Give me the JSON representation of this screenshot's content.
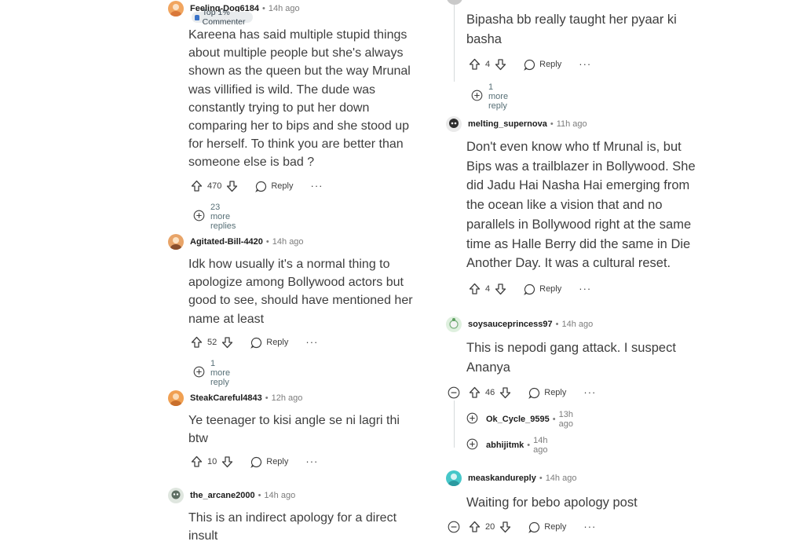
{
  "left": {
    "comments": [
      {
        "username": "Feeling-Dog6184",
        "time": "14h ago",
        "flair": "Top 1% Commenter",
        "body": "Kareena has said multiple stupid things about multiple people but she's always shown as the queen but the way Mrunal was villified is wild. The dude was constantly trying to put her down comparing her to bips and she stood up for herself. To think you are better than someone else is bad ?",
        "votes": "470",
        "reply_label": "Reply",
        "more_label": "···",
        "more_replies": "23 more replies",
        "avatar_color": "#f1a55f"
      },
      {
        "username": "Agitated-Bill-4420",
        "time": "14h ago",
        "body": "Idk how usually it's a normal thing to apologize among Bollywood actors but good to see, should have mentioned her name at least",
        "votes": "52",
        "reply_label": "Reply",
        "more_label": "···",
        "more_replies": "1 more reply",
        "avatar_color": "#e8a468"
      },
      {
        "username": "SteakCareful4843",
        "time": "12h ago",
        "body": "Ye teenager to kisi angle se ni lagri thi btw",
        "votes": "10",
        "reply_label": "Reply",
        "more_label": "···",
        "avatar_color": "#f0a052"
      },
      {
        "username": "the_arcane2000",
        "time": "14h ago",
        "body": "This is an indirect apology for a direct insult",
        "avatar_color": "#5d6e62"
      }
    ]
  },
  "right": {
    "comments": [
      {
        "id": "bipasha",
        "body": "Bipasha bb really taught her pyaar ki basha",
        "votes": "4",
        "reply_label": "Reply",
        "more_label": "···",
        "more_replies": "1 more reply"
      },
      {
        "username": "melting_supernova",
        "time": "11h ago",
        "body": "Don't even know who tf Mrunal is, but Bips was a trailblazer in Bollywood. She did Jadu Hai Nasha Hai emerging from the ocean like a vision that and no parallels in Bollywood right at the same time as Halle Berry did the same in Die Another Day. It was a cultural reset.",
        "votes": "4",
        "reply_label": "Reply",
        "more_label": "···",
        "avatar_color": "#3a3a3a"
      },
      {
        "username": "soysauceprincess97",
        "time": "14h ago",
        "body": "This is nepodi gang attack. I suspect Ananya",
        "votes": "46",
        "reply_label": "Reply",
        "more_label": "···",
        "avatar_color": "#cfe3d0",
        "sub_replies": [
          {
            "username": "Ok_Cycle_9595",
            "time": "13h ago"
          },
          {
            "username": "abhijitmk",
            "time": "14h ago"
          }
        ]
      },
      {
        "username": "measkandureply",
        "time": "14h ago",
        "body": "Waiting for bebo apology post",
        "votes": "20",
        "reply_label": "Reply",
        "more_label": "···",
        "avatar_color": "#46c7c9"
      }
    ]
  },
  "colors": {
    "meta_gray": "#7c7c7c",
    "text": "#3e3e3e",
    "thread_line": "#d6dadc",
    "more_replies": "#576f76"
  },
  "icons": [
    "upvote-icon",
    "downvote-icon",
    "reply-bubble-icon",
    "overflow-dots-icon",
    "expand-plus-icon",
    "collapse-minus-icon",
    "avatar-icon"
  ]
}
